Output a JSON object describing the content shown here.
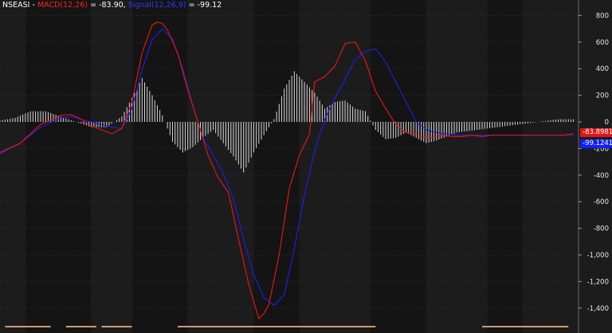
{
  "header": {
    "symbol": "NSEASI -",
    "macd_label": "MACD(12,26)",
    "macd_value": " = -83.90,",
    "signal_label": "Signal(12,26,9)",
    "signal_value": " = -99.12"
  },
  "tags": {
    "macd": "-83.8981",
    "signal": "-99.1241"
  },
  "colors": {
    "macd": "#e01515",
    "signal": "#1e1ee0",
    "histogram": "#d8d8d8",
    "background": "#1c1c1c",
    "background_dark": "#141414",
    "grid": "#3a3a3a",
    "axis_text": "#e8e8e8"
  },
  "chart_data": {
    "type": "line",
    "title": "",
    "xlabel": "",
    "ylabel": "",
    "ylim": [
      -1500,
      900
    ],
    "y_ticks": [
      800,
      600,
      400,
      200,
      0,
      -200,
      -400,
      -600,
      -800,
      -1000,
      -1200,
      -1400
    ],
    "y_tick_labels": [
      "800",
      "600",
      "400",
      "200",
      "0",
      "-200",
      "-400",
      "-600",
      "-800",
      "-1,000",
      "-1,200",
      "-1,400"
    ],
    "x_range": [
      0,
      228
    ],
    "grid": true,
    "series": [
      {
        "name": "MACD(12,26)",
        "x": [
          0,
          8,
          16,
          24,
          28,
          32,
          36,
          40,
          44,
          48,
          52,
          56,
          60,
          62,
          64,
          66,
          70,
          74,
          78,
          82,
          86,
          90,
          94,
          98,
          102,
          104,
          106,
          110,
          114,
          118,
          122,
          124,
          128,
          132,
          136,
          140,
          144,
          148,
          152,
          156,
          160,
          162,
          166,
          170,
          174,
          178,
          182,
          186,
          190,
          194,
          198,
          202,
          206,
          210,
          214,
          218,
          222,
          226
        ],
        "y": [
          -230,
          -160,
          -20,
          50,
          55,
          20,
          -30,
          -60,
          -90,
          -50,
          150,
          520,
          730,
          750,
          740,
          690,
          520,
          240,
          0,
          -250,
          -420,
          -530,
          -880,
          -1220,
          -1480,
          -1440,
          -1370,
          -1000,
          -500,
          -250,
          -90,
          300,
          340,
          420,
          590,
          600,
          460,
          230,
          100,
          -20,
          -80,
          -80,
          -110,
          -120,
          -100,
          -110,
          -110,
          -100,
          -110,
          -100,
          -100,
          -100,
          -100,
          -100,
          -100,
          -100,
          -100,
          -90
        ]
      },
      {
        "name": "Signal(12,26,9)",
        "x": [
          0,
          8,
          16,
          24,
          28,
          32,
          36,
          40,
          44,
          48,
          52,
          56,
          60,
          64,
          68,
          72,
          76,
          80,
          84,
          88,
          92,
          96,
          100,
          104,
          108,
          112,
          116,
          120,
          124,
          128,
          132,
          136,
          140,
          144,
          148,
          152,
          156,
          160,
          164,
          168,
          172,
          176,
          180,
          184,
          188,
          192,
          196,
          200,
          204,
          208,
          212,
          216,
          220,
          224,
          226
        ],
        "y": [
          -240,
          -160,
          -40,
          30,
          40,
          20,
          0,
          -20,
          -40,
          -50,
          100,
          390,
          620,
          700,
          620,
          400,
          120,
          -120,
          -250,
          -390,
          -580,
          -880,
          -1150,
          -1320,
          -1380,
          -1300,
          -950,
          -550,
          -220,
          20,
          180,
          320,
          470,
          530,
          550,
          450,
          300,
          150,
          0,
          -60,
          -80,
          -90,
          -100,
          -100,
          -100,
          -100,
          -100,
          -100,
          -100,
          -100,
          -100,
          -100,
          -100,
          -100,
          -99
        ]
      },
      {
        "name": "Histogram",
        "x": [
          0,
          6,
          12,
          18,
          24,
          30,
          36,
          42,
          48,
          52,
          56,
          60,
          64,
          68,
          72,
          76,
          80,
          84,
          88,
          92,
          96,
          100,
          104,
          108,
          112,
          116,
          120,
          124,
          128,
          132,
          136,
          140,
          144,
          148,
          152,
          156,
          160,
          164,
          168,
          172,
          176,
          180,
          184,
          188,
          192,
          196,
          200,
          204,
          208,
          212,
          216,
          220,
          224,
          226
        ],
        "y": [
          10,
          30,
          80,
          80,
          40,
          0,
          -40,
          -40,
          40,
          180,
          330,
          200,
          50,
          -150,
          -230,
          -190,
          -120,
          -60,
          -160,
          -260,
          -380,
          -230,
          -100,
          20,
          250,
          380,
          300,
          220,
          100,
          150,
          160,
          100,
          80,
          -60,
          -130,
          -120,
          -80,
          -120,
          -160,
          -140,
          -110,
          -80,
          -70,
          -60,
          -50,
          -40,
          -30,
          -20,
          -10,
          0,
          10,
          20,
          20,
          20
        ]
      }
    ],
    "bands": [
      [
        0,
        10
      ],
      [
        10,
        36
      ],
      [
        36,
        52
      ],
      [
        52,
        74
      ],
      [
        74,
        100
      ],
      [
        100,
        118
      ],
      [
        118,
        146
      ],
      [
        146,
        168
      ],
      [
        168,
        192
      ],
      [
        192,
        206
      ],
      [
        206,
        228
      ]
    ],
    "band_dark": [
      false,
      true,
      false,
      true,
      false,
      true,
      false,
      true,
      false,
      true,
      false
    ],
    "bottom_markers": [
      [
        2,
        20
      ],
      [
        26,
        38
      ],
      [
        40,
        52
      ],
      [
        70,
        148
      ],
      [
        190,
        224
      ]
    ]
  }
}
